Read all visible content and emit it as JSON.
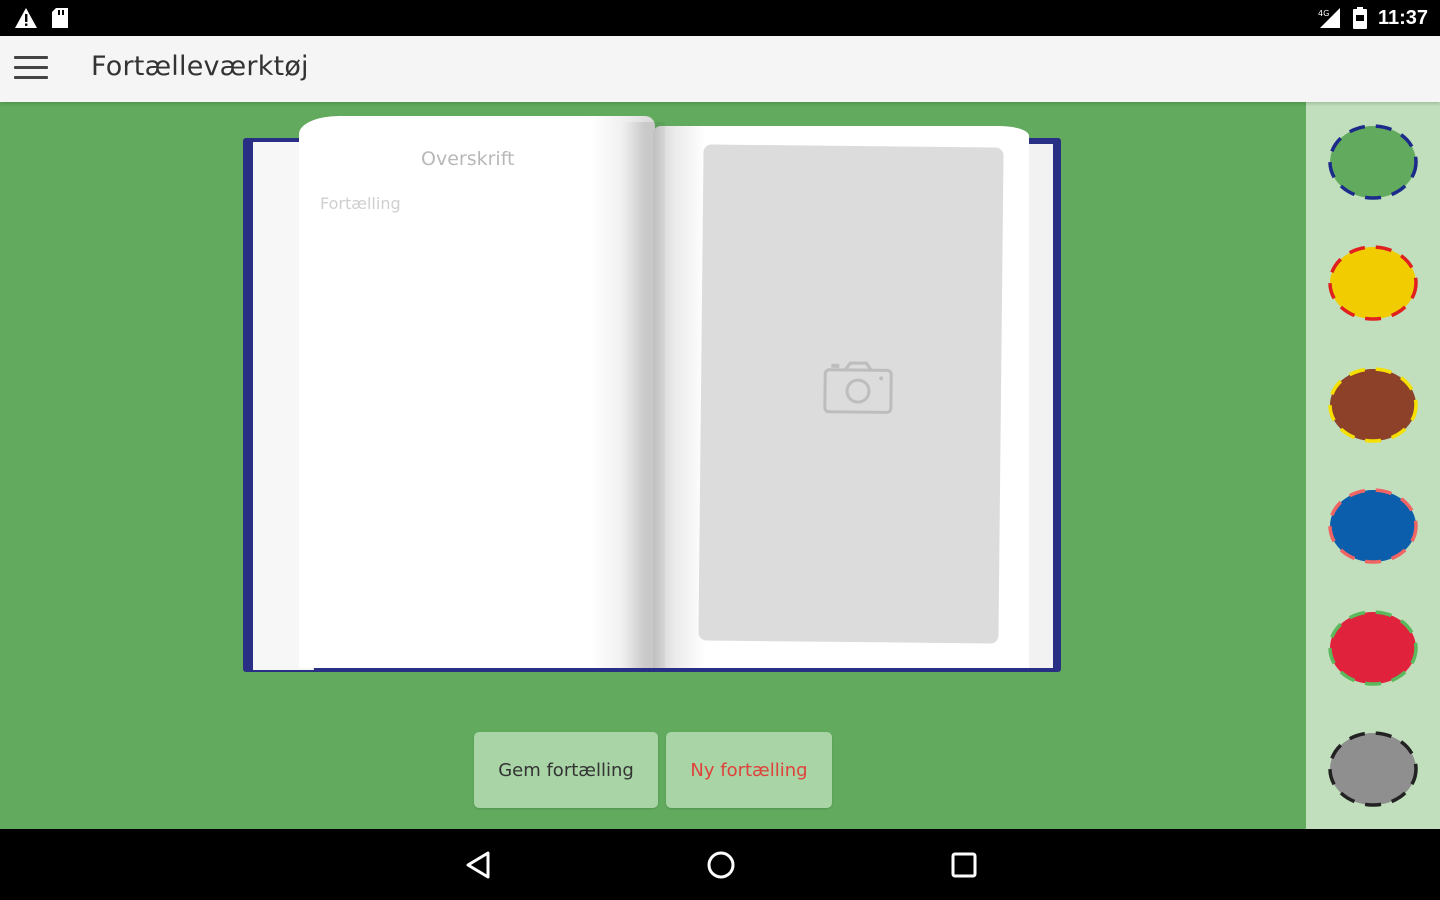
{
  "status_bar": {
    "time": "11:37",
    "left_icons": [
      "warning-icon",
      "sd-card-icon"
    ],
    "right_icons": [
      "signal-icon",
      "battery-icon"
    ]
  },
  "app_bar": {
    "title": "Fortælleværktøj",
    "menu_icon": "hamburger-menu-icon"
  },
  "book": {
    "left_page": {
      "headline_placeholder": "Overskrift",
      "story_placeholder": "Fortælling"
    },
    "right_page": {
      "photo_icon": "camera-icon"
    }
  },
  "actions": {
    "save_label": "Gem fortælling",
    "new_label": "Ny fortælling"
  },
  "color_palette": [
    {
      "fill": "#62ab5e",
      "dash": "#1c2a8a",
      "name": "green"
    },
    {
      "fill": "#f1cc00",
      "dash": "#e0201f",
      "name": "yellow"
    },
    {
      "fill": "#8c4128",
      "dash": "#f5e000",
      "name": "brown"
    },
    {
      "fill": "#0a5eab",
      "dash": "#f06464",
      "name": "blue"
    },
    {
      "fill": "#e0223c",
      "dash": "#5cb85c",
      "name": "red"
    },
    {
      "fill": "#8f8f8f",
      "dash": "#222222",
      "name": "gray"
    }
  ],
  "nav_bar": {
    "buttons": [
      "back-icon",
      "home-icon",
      "recents-icon"
    ]
  },
  "colors": {
    "background_green": "#62ab5e",
    "sidebar_green": "#c1dfbd",
    "book_cover_blue": "#2a2f86",
    "button_green": "#a8d4a6",
    "new_story_red": "#e0413b"
  }
}
